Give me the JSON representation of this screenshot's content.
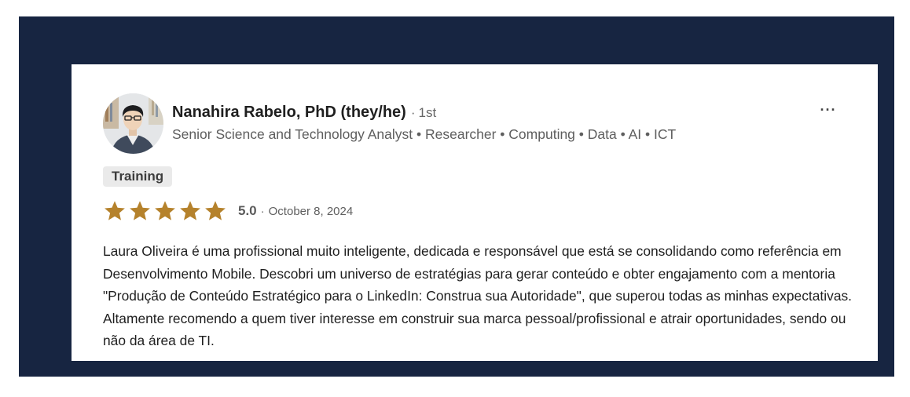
{
  "reviewer": {
    "name": "Nanahira Rabelo, PhD (they/he)",
    "degree_separator": "·",
    "degree": "1st",
    "headline": "Senior Science and Technology Analyst • Researcher • Computing • Data • AI • ICT",
    "avatar": "avatar-photo"
  },
  "more_menu": {
    "label": "···",
    "icon": "more-horizontal-icon"
  },
  "tag": {
    "label": "Training"
  },
  "rating": {
    "stars": 5,
    "max_stars": 5,
    "score": "5.0",
    "separator": "·",
    "date": "October 8, 2024",
    "star_color": "#b5822c"
  },
  "review": {
    "text": "Laura Oliveira é uma profissional muito inteligente, dedicada e responsável que está se consolidando como referência em Desenvolvimento Mobile. Descobri um universo de estratégias para gerar conteúdo e obter engajamento com a mentoria \"Produção de Conteúdo Estratégico para o LinkedIn: Construa sua Autoridade\", que superou todas as minhas expectativas. Altamente recomendo a quem tiver interesse em construir sua marca pessoal/profissional e atrair oportunidades, sendo ou não da área de TI."
  },
  "colors": {
    "frame_background": "#172541",
    "card_background": "#ffffff",
    "tag_background": "#eaeaea"
  }
}
